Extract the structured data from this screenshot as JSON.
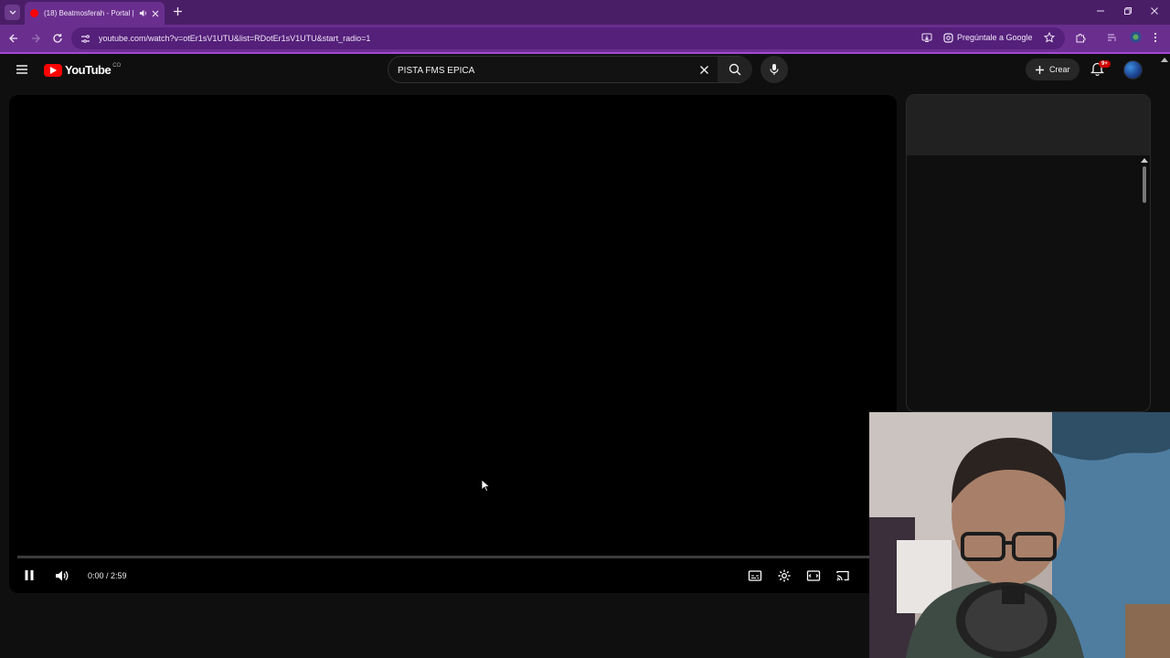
{
  "browser": {
    "tab_title": "(18) Beatmosferah - Portal |",
    "url": "youtube.com/watch?v=otEr1sV1UTU&list=RDotEr1sV1UTU&start_radio=1",
    "ask_google": "Pregúntale a Google",
    "accent_color": "#6a2f8e"
  },
  "youtube": {
    "logo_text": "YouTube",
    "country_code": "CO",
    "search_value": "PISTA FMS EPICA",
    "create_label": "Crear",
    "notifications_badge": "9+"
  },
  "player": {
    "time": "0:00 / 2:59",
    "state": "playing",
    "progress_fraction": 0
  }
}
